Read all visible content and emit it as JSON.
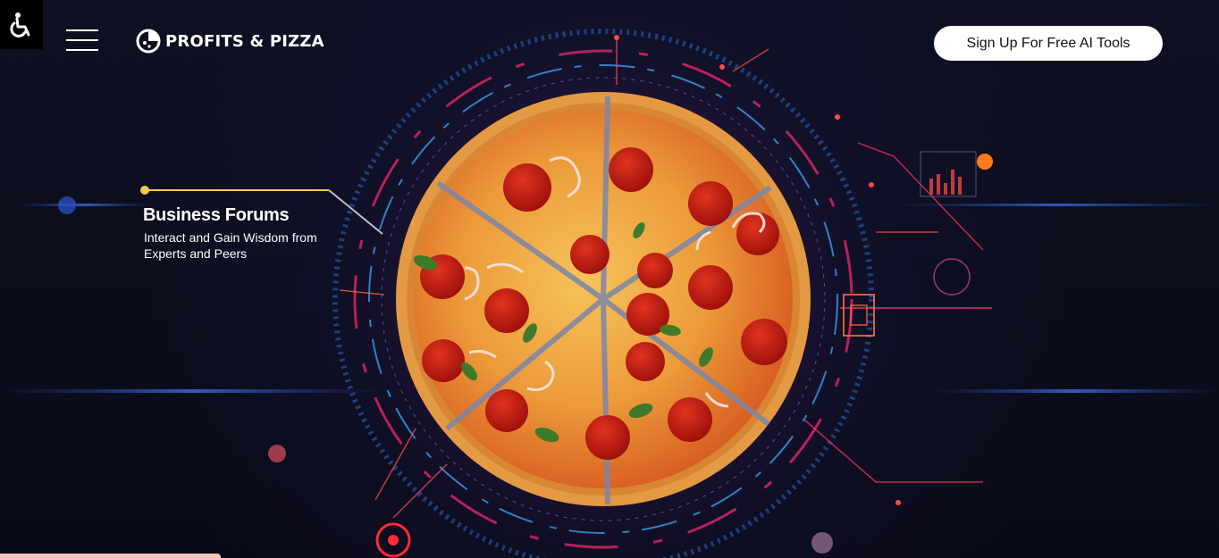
{
  "header": {
    "accessibility_icon": "wheelchair-icon",
    "menu_icon": "hamburger-menu-icon",
    "logo": {
      "icon": "pizza-chart-icon",
      "text": "PROFITS & PIZZA"
    },
    "cta_label": "Sign Up For Free AI Tools"
  },
  "hero": {
    "callout": {
      "title": "Business Forums",
      "description": "Interact and Gain Wisdom from Experts and Peers"
    }
  },
  "colors": {
    "background": "#0b0d1c",
    "crust": "#e0973d",
    "sauce": "#d7401e",
    "cheese": "#f2b64a",
    "pepperoni": "#b8140e",
    "neon_blue": "#3aa8ff",
    "neon_pink": "#ff2a6d",
    "callout_line": "#f2c94c"
  }
}
